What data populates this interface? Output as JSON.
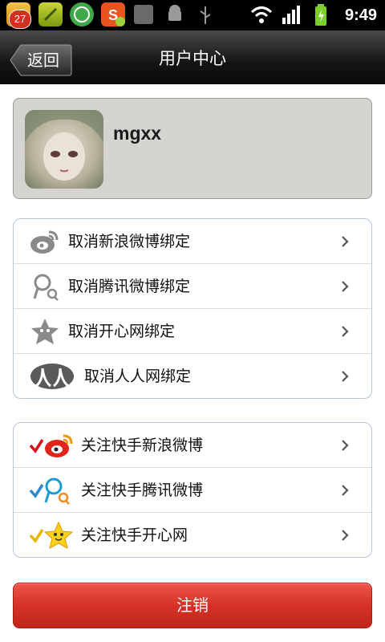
{
  "status_bar": {
    "badge_count": "27",
    "time": "9:49",
    "battery_color": "#7ccf2b"
  },
  "header": {
    "back_label": "返回",
    "title": "用户中心"
  },
  "profile": {
    "username": "mgxx"
  },
  "unbind_group": [
    {
      "label": "取消新浪微博绑定",
      "icon": "sina-weibo-icon"
    },
    {
      "label": "取消腾讯微博绑定",
      "icon": "tencent-weibo-icon"
    },
    {
      "label": "取消开心网绑定",
      "icon": "kaixin-icon"
    },
    {
      "label": "取消人人网绑定",
      "icon": "renren-icon"
    }
  ],
  "follow_group": [
    {
      "label": "关注快手新浪微博",
      "icon": "sina-weibo-check-icon"
    },
    {
      "label": "关注快手腾讯微博",
      "icon": "tencent-weibo-check-icon"
    },
    {
      "label": "关注快手开心网",
      "icon": "kaixin-check-icon"
    }
  ],
  "logout": {
    "label": "注销",
    "color": "#d43226"
  }
}
